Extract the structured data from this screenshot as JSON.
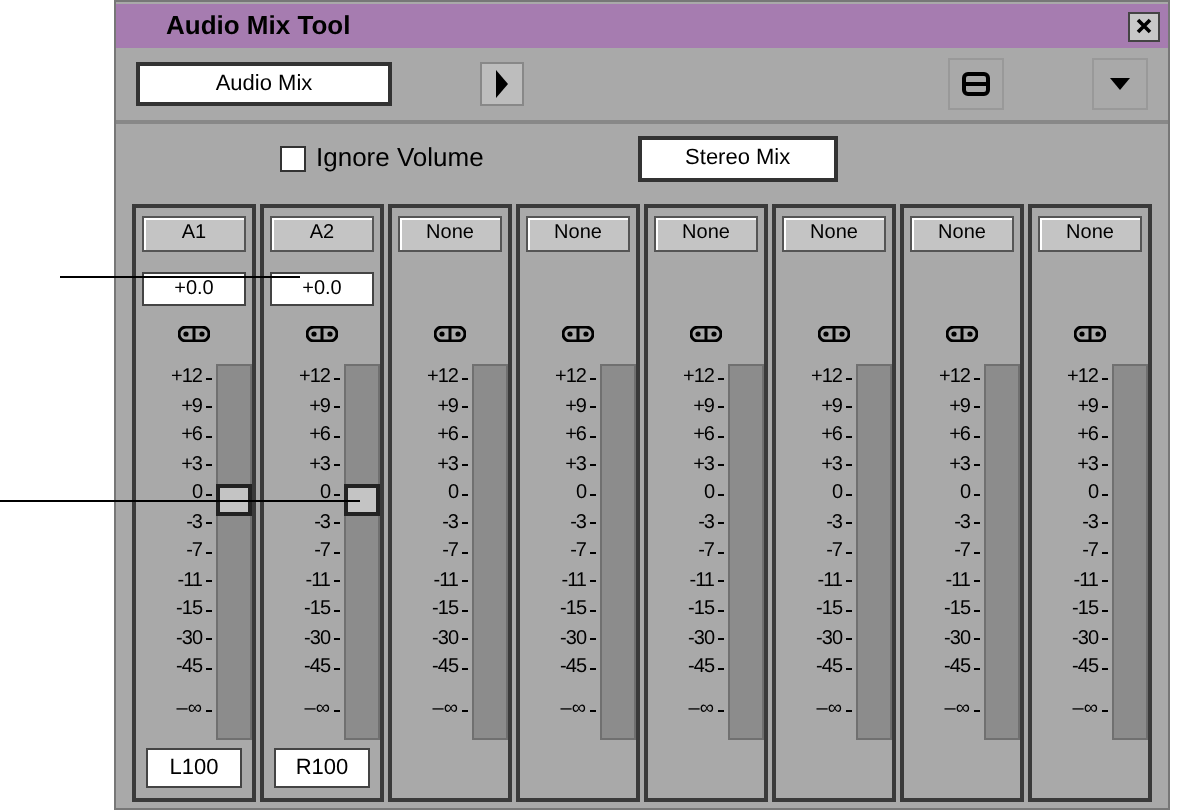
{
  "window": {
    "title": "Audio Mix Tool"
  },
  "toolbar": {
    "mix_name": "Audio Mix"
  },
  "ignore_volume": {
    "label": "Ignore Volume",
    "checked": false
  },
  "mix_mode": "Stereo Mix",
  "channels": [
    {
      "kind": "track",
      "label": "A1",
      "volume": "+0.0",
      "level": 0.64,
      "pan": "L100",
      "scale": [
        "+12",
        "+9",
        "+6",
        "+3",
        "0",
        "-3",
        "-7",
        "-11",
        "-15",
        "-30",
        "-45",
        "–∞"
      ]
    },
    {
      "kind": "track",
      "label": "A2",
      "volume": "+0.0",
      "level": 0.64,
      "pan": "R100",
      "scale": [
        "+12",
        "+9",
        "+6",
        "+3",
        "0",
        "-3",
        "-7",
        "-11",
        "-15",
        "-30",
        "-45",
        "–∞"
      ]
    },
    {
      "kind": "empty",
      "label": "None",
      "scale": [
        "+12",
        "+9",
        "+6",
        "+3",
        "0",
        "-3",
        "-7",
        "-11",
        "-15",
        "-30",
        "-45",
        "–∞"
      ]
    },
    {
      "kind": "empty",
      "label": "None",
      "scale": [
        "+12",
        "+9",
        "+6",
        "+3",
        "0",
        "-3",
        "-7",
        "-11",
        "-15",
        "-30",
        "-45",
        "–∞"
      ]
    },
    {
      "kind": "empty",
      "label": "None",
      "scale": [
        "+12",
        "+9",
        "+6",
        "+3",
        "0",
        "-3",
        "-7",
        "-11",
        "-15",
        "-30",
        "-45",
        "–∞"
      ]
    },
    {
      "kind": "empty",
      "label": "None",
      "scale": [
        "+12",
        "+9",
        "+6",
        "+3",
        "0",
        "-3",
        "-7",
        "-11",
        "-15",
        "-30",
        "-45",
        "–∞"
      ]
    },
    {
      "kind": "empty",
      "label": "None",
      "scale": [
        "+12",
        "+9",
        "+6",
        "+3",
        "0",
        "-3",
        "-7",
        "-11",
        "-15",
        "-30",
        "-45",
        "–∞"
      ]
    },
    {
      "kind": "empty",
      "label": "None",
      "scale": [
        "+12",
        "+9",
        "+6",
        "+3",
        "0",
        "-3",
        "-7",
        "-11",
        "-15",
        "-30",
        "-45",
        "–∞"
      ]
    }
  ]
}
